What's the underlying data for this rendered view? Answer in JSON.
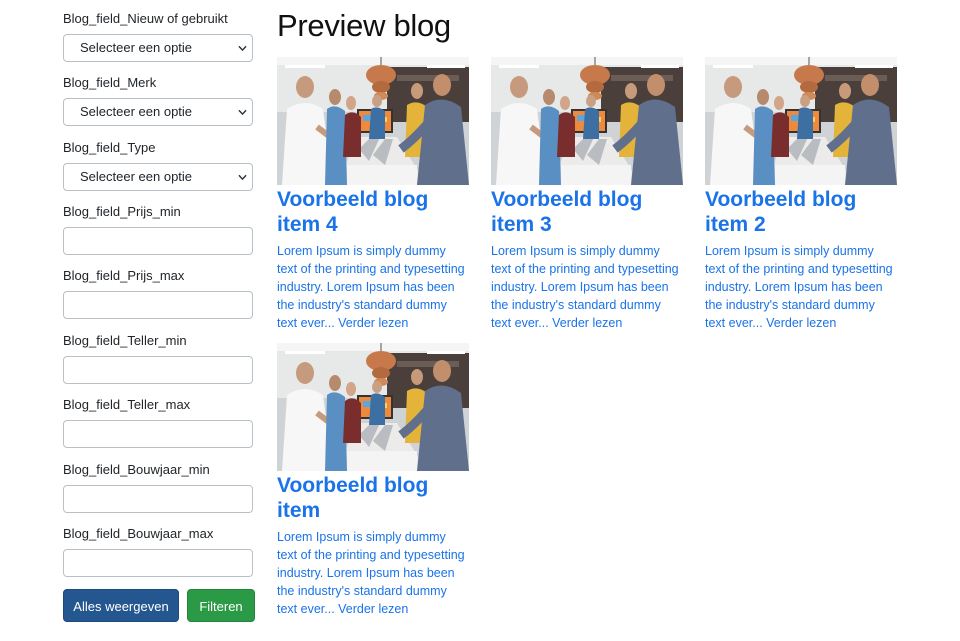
{
  "filters": {
    "fields": [
      {
        "label": "Blog_field_Nieuw of gebruikt",
        "kind": "select",
        "value": "Selecteer een optie"
      },
      {
        "label": "Blog_field_Merk",
        "kind": "select",
        "value": "Selecteer een optie"
      },
      {
        "label": "Blog_field_Type",
        "kind": "select",
        "value": "Selecteer een optie"
      },
      {
        "label": "Blog_field_Prijs_min",
        "kind": "text",
        "value": ""
      },
      {
        "label": "Blog_field_Prijs_max",
        "kind": "text",
        "value": ""
      },
      {
        "label": "Blog_field_Teller_min",
        "kind": "text",
        "value": ""
      },
      {
        "label": "Blog_field_Teller_max",
        "kind": "text",
        "value": ""
      },
      {
        "label": "Blog_field_Bouwjaar_min",
        "kind": "text",
        "value": ""
      },
      {
        "label": "Blog_field_Bouwjaar_max",
        "kind": "text",
        "value": ""
      }
    ],
    "show_all_label": "Alles weergeven",
    "filter_label": "Filteren"
  },
  "main": {
    "title": "Preview blog",
    "posts": [
      {
        "title": "Voorbeeld blog item 4",
        "excerpt": "Lorem Ipsum is simply dummy text of the printing and typesetting industry. Lorem Ipsum has been the industry's standard dummy text ever... Verder lezen"
      },
      {
        "title": "Voorbeeld blog item 3",
        "excerpt": "Lorem Ipsum is simply dummy text of the printing and typesetting industry. Lorem Ipsum has been the industry's standard dummy text ever... Verder lezen"
      },
      {
        "title": "Voorbeeld blog item 2",
        "excerpt": "Lorem Ipsum is simply dummy text of the printing and typesetting industry. Lorem Ipsum has been the industry's standard dummy text ever... Verder lezen"
      },
      {
        "title": "Voorbeeld blog item",
        "excerpt": "Lorem Ipsum is simply dummy text of the printing and typesetting industry. Lorem Ipsum has been the industry's standard dummy text ever... Verder lezen"
      }
    ]
  },
  "colors": {
    "link": "#1a73e8",
    "primary_button": "#24578f",
    "success_button": "#2a9a46"
  },
  "icons": {
    "select_arrow": "chevron-down-icon",
    "post_image": "office-team-photo"
  }
}
